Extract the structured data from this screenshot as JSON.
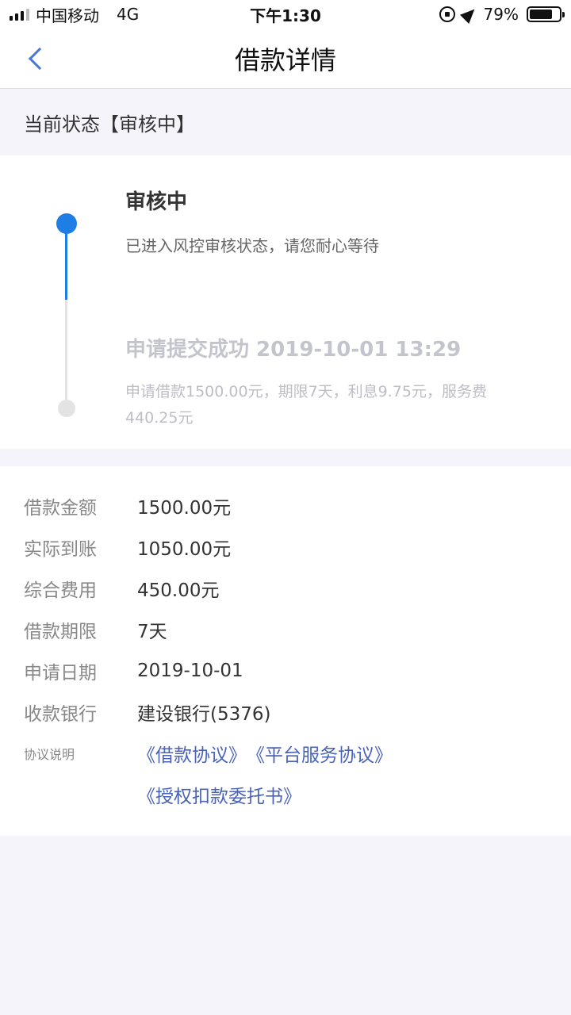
{
  "status_bar": {
    "carrier": "中国移动",
    "network": "4G",
    "time": "下午1:30",
    "battery_percent": "79%",
    "battery_level": 0.79
  },
  "nav": {
    "title": "借款详情"
  },
  "current_status": {
    "label": "当前状态【审核中】"
  },
  "timeline": [
    {
      "title": "审核中",
      "desc": "已进入风控审核状态，请您耐心等待",
      "active": true
    },
    {
      "title": "申请提交成功 2019-10-01 13:29",
      "desc": "申请借款1500.00元，期限7天，利息9.75元，服务费440.25元",
      "active": false
    }
  ],
  "details": [
    {
      "label": "借款金额",
      "value": "1500.00元"
    },
    {
      "label": "实际到账",
      "value": "1050.00元"
    },
    {
      "label": "综合费用",
      "value": "450.00元"
    },
    {
      "label": "借款期限",
      "value": "7天"
    },
    {
      "label": "申请日期",
      "value": "2019-10-01"
    },
    {
      "label": "收款银行",
      "value": "建设银行(5376)"
    }
  ],
  "agreements": {
    "label": "协议说明",
    "links": [
      "《借款协议》",
      "《平台服务协议》",
      "《授权扣款委托书》"
    ]
  },
  "colors": {
    "accent": "#1e7ee6",
    "link": "#4a63b8",
    "back": "#4a78d6"
  }
}
